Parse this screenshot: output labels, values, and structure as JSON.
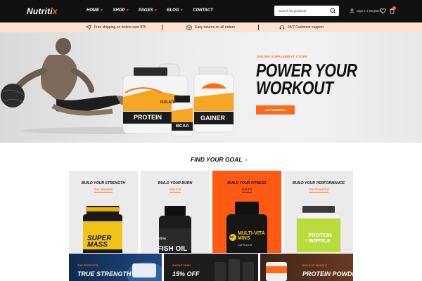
{
  "brand": {
    "logo_main": "Nutriti",
    "logo_accent": "x"
  },
  "nav": [
    {
      "label": "HOME"
    },
    {
      "label": "SHOP"
    },
    {
      "label": "PAGES"
    },
    {
      "label": "BLOG"
    },
    {
      "label": "CONTACT"
    }
  ],
  "search": {
    "placeholder": "Search for products",
    "icon": "search-icon"
  },
  "account": {
    "label": "Sign in / Register"
  },
  "cart": {
    "count": ""
  },
  "infobar": {
    "shipping": "Free shipping on orders over $75",
    "returns": "Easy returns on all orders",
    "support": "24/7 Customer support"
  },
  "hero": {
    "kicker": "ONLINE SUPPLEMENT STORE",
    "title": "POWER YOUR WORKOUT",
    "button": "GET BUNDLE",
    "products": {
      "big_tub_label": "ISOLATE",
      "big_tub_name": "PROTEIN",
      "small_tub_name": "GAINER",
      "bottle_name": "BCAA"
    }
  },
  "goals": {
    "title": "FIND YOUR GOAL",
    "cards": [
      {
        "title": "BUILD YOUR STRENGTH",
        "link": "Get Muscles",
        "product_text": "SUPER MASS"
      },
      {
        "title": "BUILD YOUR BURN",
        "link": "Get Cut",
        "product_text": "FISH OIL",
        "product_tag": "Yellow"
      },
      {
        "title": "BUILD YOUR FITNESS",
        "link": "Get Fit",
        "product_text": "MULTI-VITAMINS",
        "product_sub": "CAPSULES",
        "product_badge": "50"
      },
      {
        "title": "BUILD YOUR PERFORMANCE",
        "link": "Get Powerful",
        "product_text": "PROTEIN BOTTLE",
        "product_sub": "SUPPLEMENTS"
      }
    ]
  },
  "promos": [
    {
      "kicker": "TOP PRODUCTS",
      "title": "TRUE STRENGTH"
    },
    {
      "kicker": "SAVING PUSH",
      "title": "15% OFF"
    },
    {
      "kicker": "BUILD UP MUSCLE",
      "title": "PROTEIN POWDER"
    }
  ],
  "colors": {
    "accent": "#ff6a1a",
    "header_bg": "#111111",
    "infobar_bg": "#fde2d2",
    "active_card": "#ff5a14"
  }
}
